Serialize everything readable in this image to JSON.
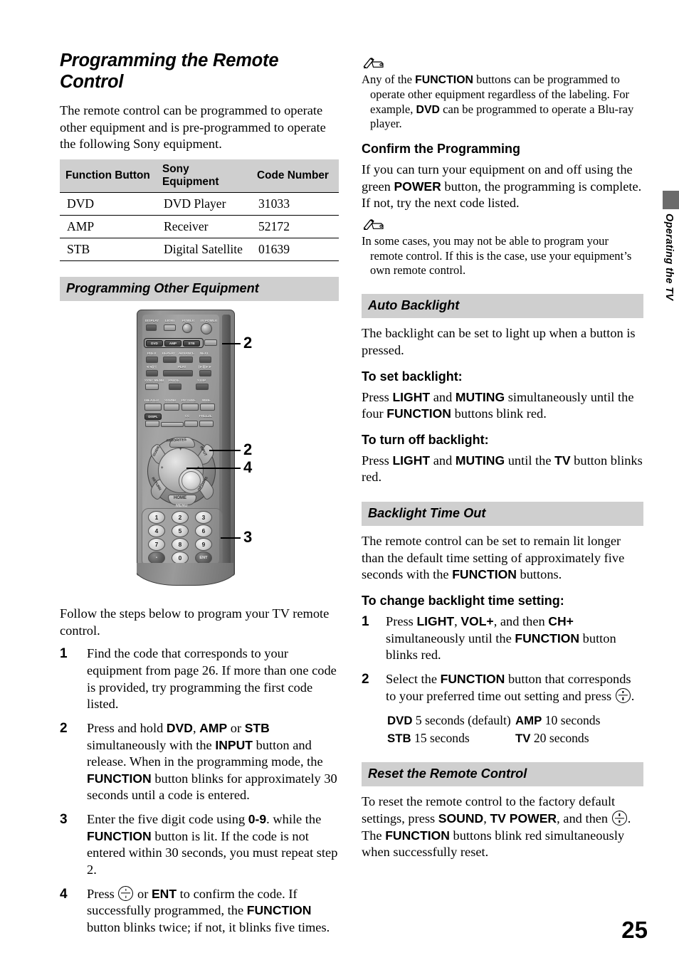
{
  "page_number": "25",
  "side_tab": {
    "label": "Operating the TV",
    "color": "#6b6b6b"
  },
  "left_column": {
    "title": "Programming the Remote Control",
    "intro": "The remote control can be programmed to operate other equipment and is pre-programmed to operate the following Sony equipment.",
    "table": {
      "headers": [
        "Function Button",
        "Sony Equipment",
        "Code Number"
      ],
      "rows": [
        [
          "DVD",
          "DVD Player",
          "31033"
        ],
        [
          "AMP",
          "Receiver",
          "52172"
        ],
        [
          "STB",
          "Digital Satellite",
          "01639"
        ]
      ]
    },
    "section_header": "Programming Other Equipment",
    "figure": {
      "callouts": [
        "2",
        "2",
        "4",
        "3"
      ],
      "remote_labels": {
        "top_row": [
          "DISPLAY",
          "LIGHT",
          "POWER",
          "TV POWER"
        ],
        "function_buttons": [
          "DVD",
          "AMP",
          "STB"
        ],
        "transport_row1": [
          "PREV",
          "REPLAY",
          "ADVANCE",
          "NEXT"
        ],
        "transport_row2": [
          "PLAY"
        ],
        "transport_row3": [
          "SYNC MENU",
          "PAUSE",
          "STOP"
        ],
        "feature_row1": [
          "THEATER",
          "SOUND",
          "PICTURE",
          "WIDE"
        ],
        "feature_row2": [
          "DISPL",
          "CC",
          "FREEZE"
        ],
        "dpad": [
          "GUIDE",
          "FAVORITES",
          "INPUT",
          "RETURN",
          "OPTIONS",
          "HOME",
          "MENU"
        ],
        "numpad": [
          "1",
          "2",
          "3",
          "4",
          "5",
          "6",
          "7",
          "8",
          "9",
          "0",
          "ENT"
        ],
        "channel": "CH"
      }
    },
    "follow_text": "Follow the steps below to program your TV remote control.",
    "steps": [
      {
        "num": "1",
        "html": "Find the code that corresponds to your equipment from page 26. If more than one code is provided, try programming the first code listed."
      },
      {
        "num": "2",
        "html": "Press and hold <b>DVD</b>, <b>AMP</b> or <b>STB</b> simultaneously with the <b>INPUT</b> button and release. When in the programming mode, the <b>FUNCTION</b> button blinks for approximately 30 seconds until a code is entered."
      },
      {
        "num": "3",
        "html": "Enter the five digit code using <b>0-9</b>. while the <b>FUNCTION</b> button is lit. If the code is not entered within 30 seconds, you must repeat step 2."
      },
      {
        "num": "4",
        "html": "Press <span class=\"enter-glyph\" data-name=\"enter-button-glyph\"><i></i></span> or <b>ENT</b> to confirm the code. If successfully programmed, the <b>FUNCTION</b> button blinks twice; if not, it blinks five times."
      }
    ]
  },
  "right_column": {
    "note_1": "Any of the <b>FUNCTION</b> buttons can be programmed to operate other equipment regardless of the labeling. For example, <b>DVD</b> can be programmed to operate a Blu-ray player.",
    "confirm": {
      "heading": "Confirm the Programming",
      "body": "If you can turn your equipment on and off using the green <b>POWER</b> button, the programming is complete. If not, try the next code listed.",
      "note": "In some cases, you may not be able to program your remote control. If this is the case, use your equipment’s own remote control."
    },
    "auto_backlight": {
      "header": "Auto Backlight",
      "body": "The backlight can be set to light up when a button is pressed.",
      "sub_1": "To set backlight:",
      "body_1": "Press <b>LIGHT</b> and <b>MUTING</b> simultaneously until the four <b>FUNCTION</b> buttons blink red.",
      "sub_2": "To turn off backlight:",
      "body_2": "Press <b>LIGHT</b> and <b>MUTING</b> until the <b>TV</b> button blinks red."
    },
    "backlight_time_out": {
      "header": "Backlight Time Out",
      "body": "The remote control can be set to remain lit longer than the default time setting of approximately five seconds with the <b>FUNCTION</b> buttons.",
      "sub": "To change backlight time setting:",
      "steps": [
        {
          "num": "1",
          "html": "Press <b>LIGHT</b>, <b>VOL+</b>, and then <b>CH+</b> simultaneously until the <b>FUNCTION</b> button blinks red."
        },
        {
          "num": "2",
          "html": "Select the <b>FUNCTION</b> button that corresponds to your preferred time out setting and press <span class=\"enter-glyph\" data-name=\"enter-button-glyph\"><i></i></span>."
        }
      ],
      "timeout_table": [
        {
          "key": "DVD",
          "value": "5 seconds (default)"
        },
        {
          "key": "AMP",
          "value": "10 seconds"
        },
        {
          "key": "STB",
          "value": "15 seconds"
        },
        {
          "key": "TV",
          "value": "20 seconds"
        }
      ]
    },
    "reset": {
      "header": "Reset the Remote Control",
      "body": "To reset the remote control to the factory default settings, press <b>SOUND</b>, <b>TV POWER</b>, and then <span class=\"enter-glyph\" data-name=\"enter-button-glyph\"><i></i></span>. The <b>FUNCTION</b> buttons blink red simultaneously when successfully reset."
    }
  }
}
